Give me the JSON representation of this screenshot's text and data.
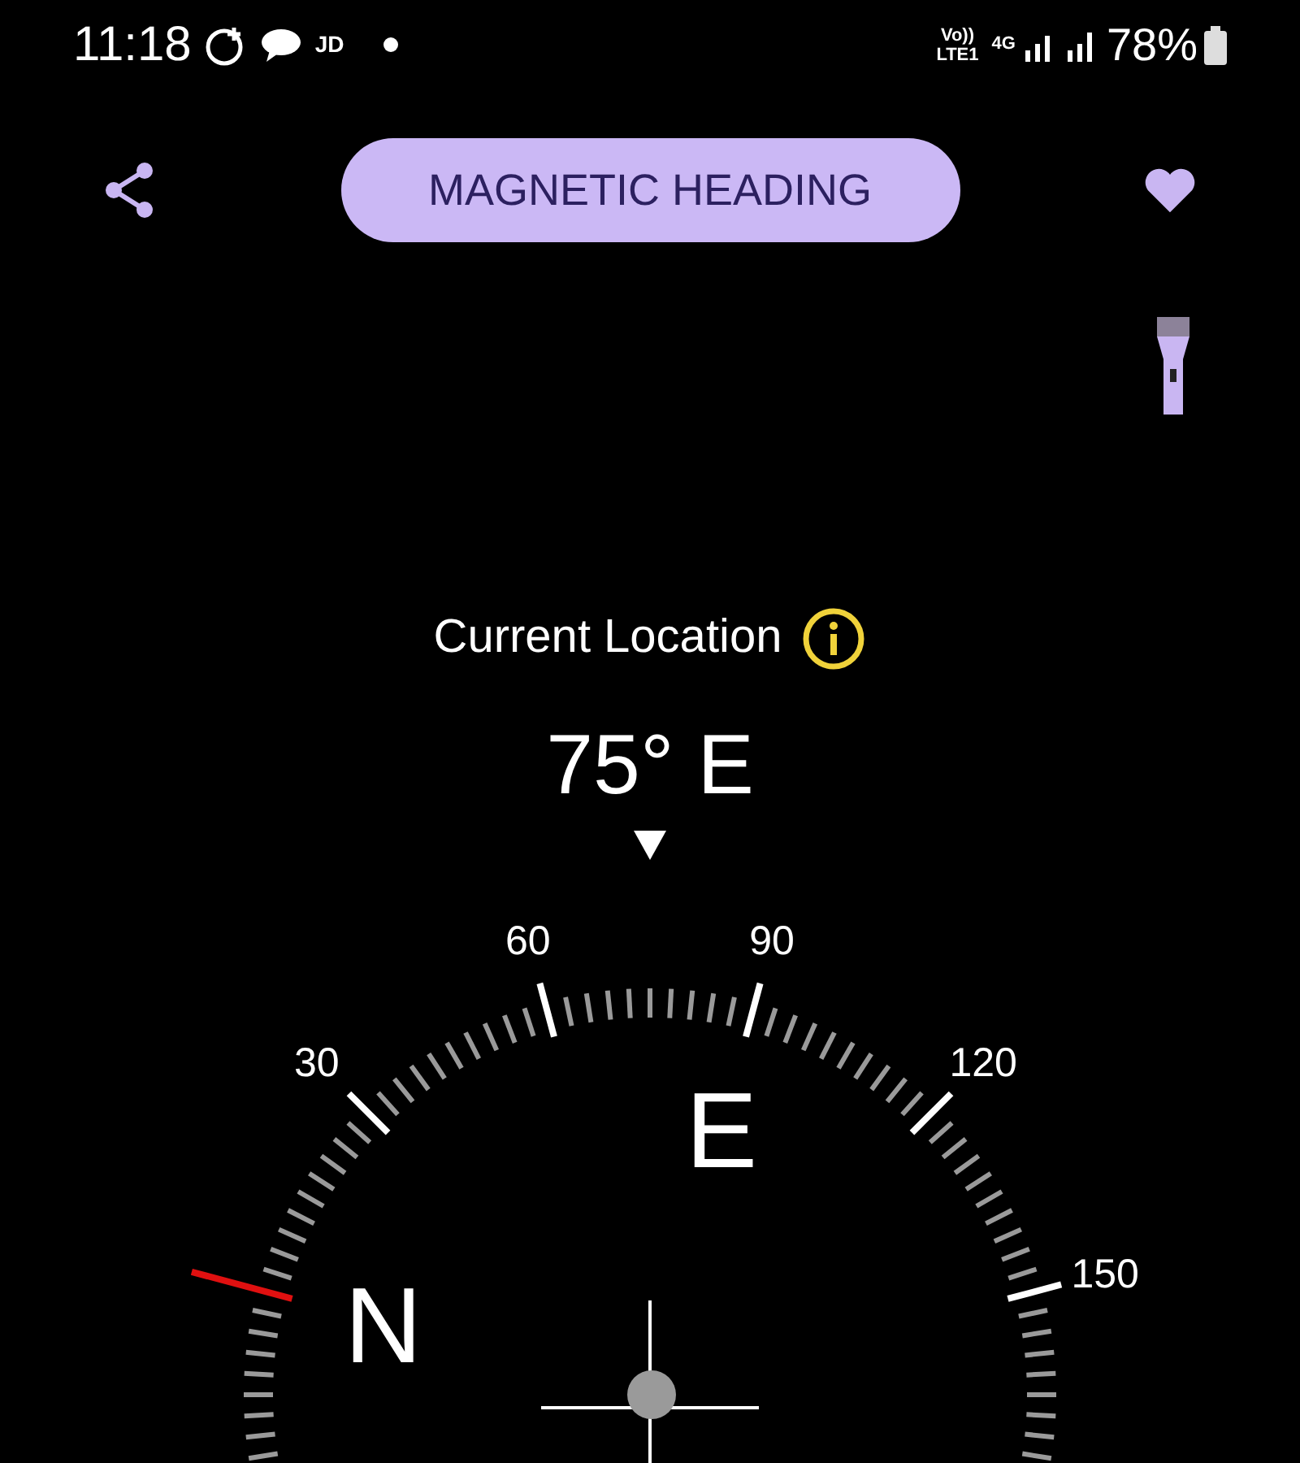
{
  "status_bar": {
    "time": "11:18",
    "carrier": "JD",
    "network_top": "Vo))",
    "network_bottom": "LTE1",
    "data_type": "4G",
    "battery": "78%"
  },
  "toolbar": {
    "mode_button": "MAGNETIC HEADING"
  },
  "location": {
    "label": "Current Location"
  },
  "heading": {
    "reading": "75° E"
  },
  "dial": {
    "degree_labels": [
      "30",
      "60",
      "90",
      "120",
      "150"
    ],
    "cardinals": [
      "N",
      "E"
    ]
  }
}
